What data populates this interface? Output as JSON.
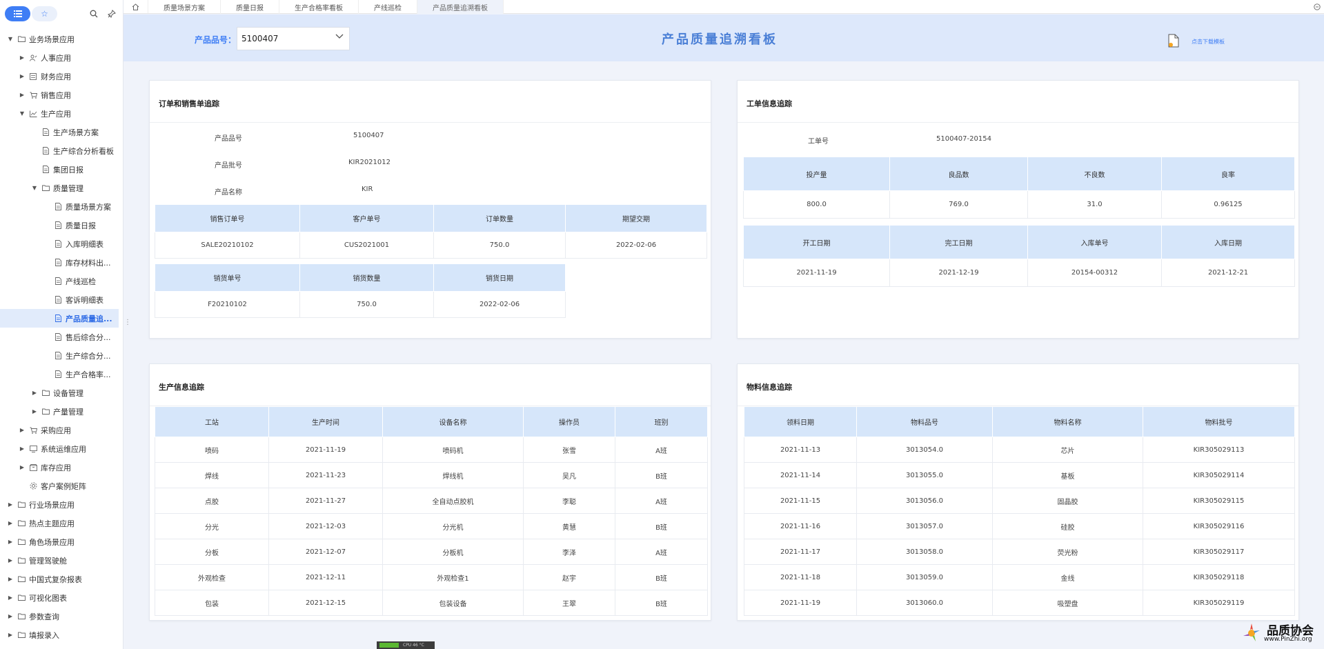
{
  "sidebar": {
    "tree": [
      {
        "label": "业务场景应用",
        "level": 0,
        "arrow": "open",
        "icon": "folder-icon"
      },
      {
        "label": "人事应用",
        "level": 1,
        "arrow": "closed",
        "icon": "people-icon"
      },
      {
        "label": "财务应用",
        "level": 1,
        "arrow": "closed",
        "icon": "ledger-icon"
      },
      {
        "label": "销售应用",
        "level": 1,
        "arrow": "closed",
        "icon": "cart-icon"
      },
      {
        "label": "生产应用",
        "level": 1,
        "arrow": "open",
        "icon": "chart-icon"
      },
      {
        "label": "生产场景方案",
        "level": 2,
        "arrow": "none",
        "icon": "doc-icon"
      },
      {
        "label": "生产综合分析看板",
        "level": 2,
        "arrow": "none",
        "icon": "doc-icon"
      },
      {
        "label": "集团日报",
        "level": 2,
        "arrow": "none",
        "icon": "doc-icon"
      },
      {
        "label": "质量管理",
        "level": 2,
        "arrow": "open",
        "icon": "folder-icon"
      },
      {
        "label": "质量场景方案",
        "level": 3,
        "arrow": "none",
        "icon": "doc-icon"
      },
      {
        "label": "质量日报",
        "level": 3,
        "arrow": "none",
        "icon": "doc-icon"
      },
      {
        "label": "入库明细表",
        "level": 3,
        "arrow": "none",
        "icon": "doc-icon"
      },
      {
        "label": "库存材料出...",
        "level": 3,
        "arrow": "none",
        "icon": "doc-icon"
      },
      {
        "label": "产线巡检",
        "level": 3,
        "arrow": "none",
        "icon": "doc-icon"
      },
      {
        "label": "客诉明细表",
        "level": 3,
        "arrow": "none",
        "icon": "doc-icon"
      },
      {
        "label": "产品质量追...",
        "level": 3,
        "arrow": "none",
        "icon": "doc-icon",
        "selected": true
      },
      {
        "label": "售后综合分...",
        "level": 3,
        "arrow": "none",
        "icon": "doc-icon"
      },
      {
        "label": "生产综合分...",
        "level": 3,
        "arrow": "none",
        "icon": "doc-icon"
      },
      {
        "label": "生产合格率...",
        "level": 3,
        "arrow": "none",
        "icon": "doc-icon"
      },
      {
        "label": "设备管理",
        "level": 2,
        "arrow": "closed",
        "icon": "folder-icon"
      },
      {
        "label": "产量管理",
        "level": 2,
        "arrow": "closed",
        "icon": "folder-icon"
      },
      {
        "label": "采购应用",
        "level": 1,
        "arrow": "closed",
        "icon": "cart-icon"
      },
      {
        "label": "系统运维应用",
        "level": 1,
        "arrow": "closed",
        "icon": "monitor-icon"
      },
      {
        "label": "库存应用",
        "level": 1,
        "arrow": "closed",
        "icon": "box-icon"
      },
      {
        "label": "客户案例矩阵",
        "level": 1,
        "arrow": "none",
        "icon": "gear-icon"
      },
      {
        "label": "行业场景应用",
        "level": 0,
        "arrow": "closed",
        "icon": "folder-icon"
      },
      {
        "label": "热点主题应用",
        "level": 0,
        "arrow": "closed",
        "icon": "folder-icon"
      },
      {
        "label": "角色场景应用",
        "level": 0,
        "arrow": "closed",
        "icon": "folder-icon"
      },
      {
        "label": "管理驾驶舱",
        "level": 0,
        "arrow": "closed",
        "icon": "folder-icon"
      },
      {
        "label": "中国式复杂报表",
        "level": 0,
        "arrow": "closed",
        "icon": "folder-icon"
      },
      {
        "label": "可视化图表",
        "level": 0,
        "arrow": "closed",
        "icon": "folder-icon"
      },
      {
        "label": "参数查询",
        "level": 0,
        "arrow": "closed",
        "icon": "folder-icon"
      },
      {
        "label": "填报录入",
        "level": 0,
        "arrow": "closed",
        "icon": "folder-icon"
      }
    ]
  },
  "tabs": [
    "质量场景方案",
    "质量日报",
    "生产合格率看板",
    "产线巡检",
    "产品质量追溯看板"
  ],
  "header": {
    "filter_label": "产品品号：",
    "filter_value": "5100407",
    "title": "产品质量追溯看板",
    "download_label": "点击下载模板"
  },
  "order_card": {
    "title": "订单和销售单追踪",
    "kv": [
      {
        "label": "产品品号",
        "value": "5100407"
      },
      {
        "label": "产品批号",
        "value": "KIR2021012"
      },
      {
        "label": "产品名称",
        "value": "KIR"
      }
    ],
    "sales_table": {
      "headers": [
        "销售订单号",
        "客户单号",
        "订单数量",
        "期望交期"
      ],
      "rows": [
        [
          "SALE20210102",
          "CUS2021001",
          "750.0",
          "2022-02-06"
        ]
      ]
    },
    "ship_table": {
      "headers": [
        "销货单号",
        "销货数量",
        "销货日期"
      ],
      "rows": [
        [
          "F20210102",
          "750.0",
          "2022-02-06"
        ]
      ]
    }
  },
  "workorder_card": {
    "title": "工单信息追踪",
    "kv_label": "工单号",
    "kv_value": "5100407-20154",
    "qty_table": {
      "headers": [
        "投产量",
        "良品数",
        "不良数",
        "良率"
      ],
      "rows": [
        [
          "800.0",
          "769.0",
          "31.0",
          "0.96125"
        ]
      ]
    },
    "date_table": {
      "headers": [
        "开工日期",
        "完工日期",
        "入库单号",
        "入库日期"
      ],
      "rows": [
        [
          "2021-11-19",
          "2021-12-19",
          "20154-00312",
          "2021-12-21"
        ]
      ]
    }
  },
  "production_card": {
    "title": "生产信息追踪",
    "headers": [
      "工站",
      "生产时间",
      "设备名称",
      "操作员",
      "班别"
    ],
    "rows": [
      [
        "喷码",
        "2021-11-19",
        "喷码机",
        "张雪",
        "A班"
      ],
      [
        "焊线",
        "2021-11-23",
        "焊线机",
        "吴凡",
        "B班"
      ],
      [
        "点胶",
        "2021-11-27",
        "全自动点胶机",
        "李聪",
        "A班"
      ],
      [
        "分光",
        "2021-12-03",
        "分光机",
        "黄慧",
        "B班"
      ],
      [
        "分板",
        "2021-12-07",
        "分板机",
        "李泽",
        "A班"
      ],
      [
        "外观检查",
        "2021-12-11",
        "外观检查1",
        "赵宇",
        "B班"
      ],
      [
        "包装",
        "2021-12-15",
        "包装设备",
        "王翠",
        "B班"
      ]
    ]
  },
  "material_card": {
    "title": "物料信息追踪",
    "headers": [
      "领料日期",
      "物料品号",
      "物料名称",
      "物料批号"
    ],
    "rows": [
      [
        "2021-11-13",
        "3013054.0",
        "芯片",
        "KIR305029113"
      ],
      [
        "2021-11-14",
        "3013055.0",
        "基板",
        "KIR305029114"
      ],
      [
        "2021-11-15",
        "3013056.0",
        "固晶胶",
        "KIR305029115"
      ],
      [
        "2021-11-16",
        "3013057.0",
        "硅胶",
        "KIR305029116"
      ],
      [
        "2021-11-17",
        "3013058.0",
        "荧光粉",
        "KIR305029117"
      ],
      [
        "2021-11-18",
        "3013059.0",
        "金线",
        "KIR305029118"
      ],
      [
        "2021-11-19",
        "3013060.0",
        "吸塑盘",
        "KIR305029119"
      ]
    ]
  },
  "status_bar": {
    "text": "CPU 46 °C"
  },
  "watermark": {
    "title": "品质协会",
    "url": "www.PinZhi.org"
  },
  "colors": {
    "accent": "#3f7ef5",
    "header_bg": "#dde8fb",
    "table_header": "#d6e6fa",
    "title": "#4a7fd6"
  }
}
